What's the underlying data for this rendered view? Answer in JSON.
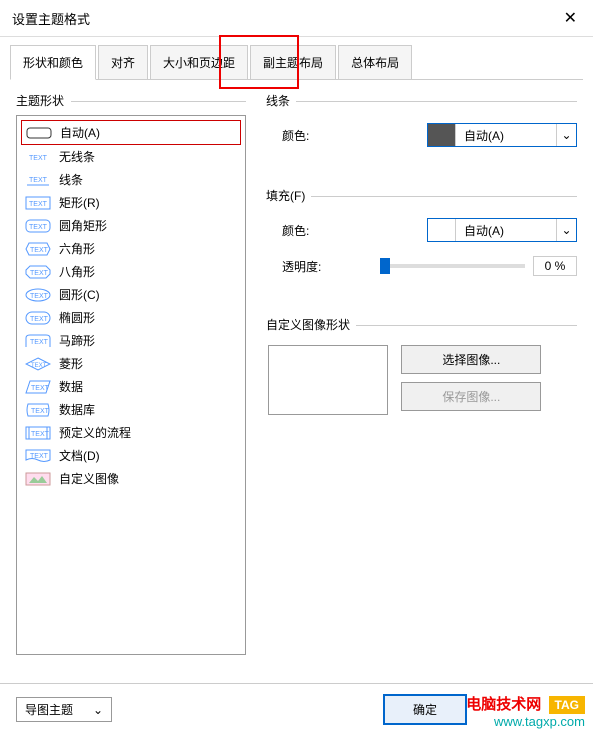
{
  "dialog": {
    "title": "设置主题格式"
  },
  "tabs": {
    "items": [
      {
        "label": "形状和颜色"
      },
      {
        "label": "对齐"
      },
      {
        "label": "大小和页边距"
      },
      {
        "label": "副主题布局"
      },
      {
        "label": "总体布局"
      }
    ]
  },
  "shapes": {
    "groupLabel": "主题形状",
    "items": [
      {
        "label": "自动(A)"
      },
      {
        "label": "无线条"
      },
      {
        "label": "线条"
      },
      {
        "label": "矩形(R)"
      },
      {
        "label": "圆角矩形"
      },
      {
        "label": "六角形"
      },
      {
        "label": "八角形"
      },
      {
        "label": "圆形(C)"
      },
      {
        "label": "椭圆形"
      },
      {
        "label": "马蹄形"
      },
      {
        "label": "菱形"
      },
      {
        "label": "数据"
      },
      {
        "label": "数据库"
      },
      {
        "label": "预定义的流程"
      },
      {
        "label": "文档(D)"
      },
      {
        "label": "自定义图像"
      }
    ]
  },
  "line": {
    "groupLabel": "线条",
    "colorLabel": "颜色:",
    "colorValue": "自动(A)"
  },
  "fill": {
    "groupLabel": "填充(F)",
    "colorLabel": "颜色:",
    "colorValue": "自动(A)",
    "opacityLabel": "透明度:",
    "opacityValue": "0 %"
  },
  "customImage": {
    "groupLabel": "自定义图像形状",
    "selectBtn": "选择图像...",
    "saveBtn": "保存图像..."
  },
  "bottom": {
    "topicSelect": "导图主题",
    "okBtn": "确定"
  },
  "watermark": {
    "text": "电脑技术网",
    "tag": "TAG",
    "url": "www.tagxp.com"
  }
}
